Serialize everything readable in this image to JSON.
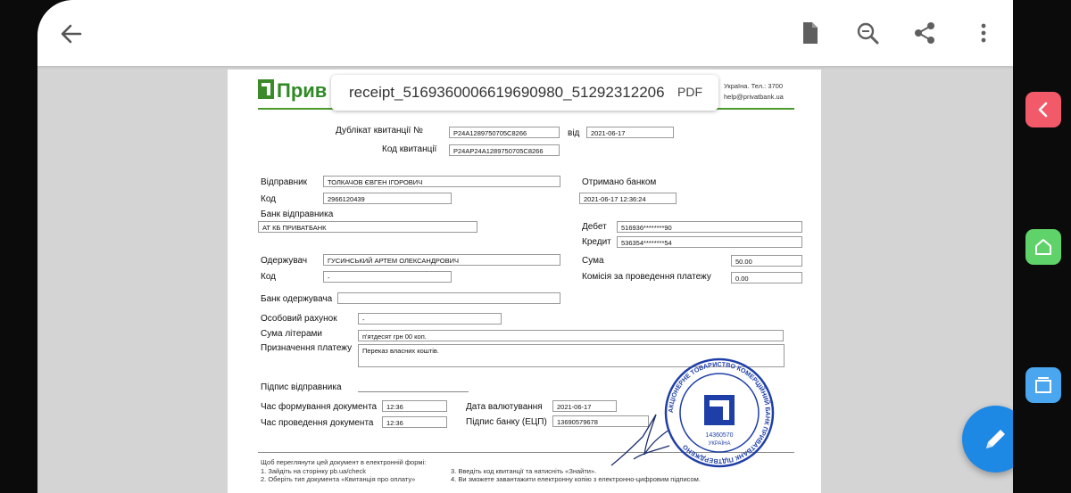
{
  "app": {
    "back_label": "Back",
    "file_name": "receipt_5169360006619690980_51292312206",
    "file_type": "PDF"
  },
  "header": {
    "logo_text": "Прив",
    "contact_line1": "Україна. Тел.: 3700",
    "contact_line2": "help@privatbank.ua",
    "brand_color": "#4a9a2c"
  },
  "receipt": {
    "duplicate_label": "Дублікат квитанції №",
    "duplicate_value": "P24A1289750705C8266",
    "from_label": "від",
    "from_value": "2021-06-17",
    "code_label": "Код квитанції",
    "code_value": "P24AP24A1289750705C8266",
    "sender_label": "Відправник",
    "sender_value": "ТОЛКАЧОВ ЄВГЕН ІГОРОВИЧ",
    "sender_code_label": "Код",
    "sender_code_value": "2966120439",
    "sender_bank_label": "Банк відправника",
    "sender_bank_value": "АТ КБ ПРИВАТБАНК",
    "received_label": "Отримано банком",
    "received_value": "2021-06-17 12:36:24",
    "debit_label": "Дебет",
    "debit_value": "516936********90",
    "credit_label": "Кредит",
    "credit_value": "536354********54",
    "recipient_label": "Одержувач",
    "recipient_value": "ГУСИНСЬКИЙ АРТЕМ ОЛЕКСАНДРОВИЧ",
    "recipient_code_label": "Код",
    "recipient_code_value": "-",
    "sum_label": "Сума",
    "sum_value": "50.00",
    "fee_label": "Комісія за проведення платежу",
    "fee_value": "0.00",
    "recipient_bank_label": "Банк одержувача",
    "recipient_bank_value": "",
    "personal_account_label": "Особовий рахунок",
    "personal_account_value": "-",
    "sum_words_label": "Сума літерами",
    "sum_words_value": "п'ятдесят грн 00 коп.",
    "purpose_label": "Призначення платежу",
    "purpose_value": "Переказ власних коштів.",
    "sender_signature_label": "Підпис відправника",
    "doc_formed_label": "Час формування документа",
    "doc_formed_value": "12:36",
    "doc_processed_label": "Час проведення документа",
    "doc_processed_value": "12:36",
    "value_date_label": "Дата валютування",
    "value_date_value": "2021-06-17",
    "bank_signature_label": "Підпис банку (ЕЦП)",
    "bank_signature_value": "13690579678"
  },
  "footer": {
    "title": "Щоб переглянути цей документ в електронній формі:",
    "step1": "1. Зайдіть на сторінку pb.ua/check",
    "step2": "2. Оберіть тип документа «Квитанція про оплату»",
    "step3": "3. Введіть код квитанції та натисніть «Знайти».",
    "step4": "4. Ви зможете завантажити електронну копію з електронно-цифровим підписом."
  },
  "stamp": {
    "text": "АКЦІОНЕРНЕ ТОВАРИСТВО КОМЕРЦІЙНИЙ БАНК ПРИВАТБАНК ПІДТВЕРДЖЕНО",
    "code": "14360570",
    "country": "УКРАЇНА",
    "color": "#1f3fa8"
  },
  "colors": {
    "fab": "#1e88e5",
    "side_back": "#f25a6a",
    "side_home": "#5fd36a",
    "side_windows": "#4aa7ef"
  }
}
